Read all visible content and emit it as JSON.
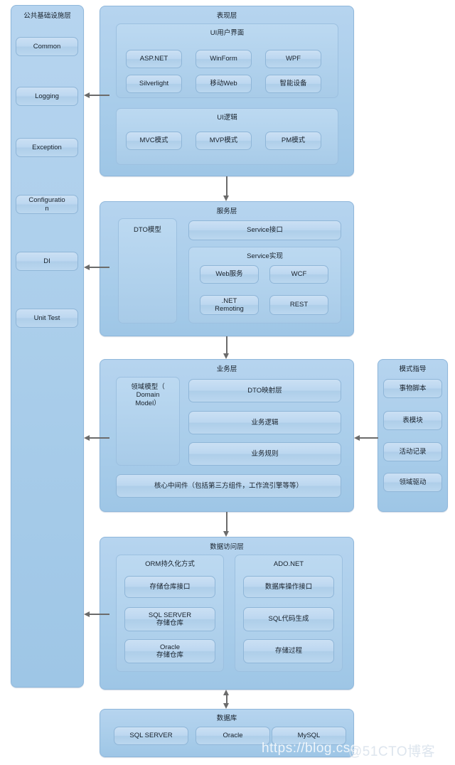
{
  "diagram": {
    "infrastructure": {
      "title": "公共基础设施层",
      "items": [
        {
          "label": "Common"
        },
        {
          "label": "Logging"
        },
        {
          "label": "Exception"
        },
        {
          "label": "Configuratio\nn"
        },
        {
          "label": "DI"
        },
        {
          "label": "Unit Test"
        }
      ]
    },
    "presentation": {
      "title": "表现层",
      "groups": [
        {
          "title": "UI用户界面",
          "items": [
            "ASP.NET",
            "WinForm",
            "WPF",
            "Silverlight",
            "移动Web",
            "智能设备"
          ]
        },
        {
          "title": "UI逻辑",
          "items": [
            "MVC模式",
            "MVP模式",
            "PM模式"
          ]
        }
      ]
    },
    "service": {
      "title": "服务层",
      "dto_model": "DTO模型",
      "interface": "Service接口",
      "impl": {
        "title": "Service实现",
        "items": [
          "Web服务",
          "WCF",
          ".NET\nRemoting",
          "REST"
        ]
      }
    },
    "business": {
      "title": "业务层",
      "domain_model": "领域模型（\nDomain\nModel）",
      "items": [
        "DTO映射层",
        "业务逻辑",
        "业务规则"
      ],
      "middleware": "核心中间件（包括第三方组件，工作流引擎等等）"
    },
    "patterns": {
      "title": "模式指导",
      "items": [
        "事物脚本",
        "表模块",
        "活动记录",
        "领域驱动"
      ]
    },
    "data_access": {
      "title": "数据访问层",
      "groups": [
        {
          "title": "ORM持久化方式",
          "items": [
            "存储仓库接口",
            "SQL SERVER\n存储仓库",
            "Oracle\n存储仓库"
          ]
        },
        {
          "title": "ADO.NET",
          "items": [
            "数据库操作接口",
            "SQL代码生成",
            "存储过程"
          ]
        }
      ]
    },
    "database": {
      "title": "数据库",
      "items": [
        "SQL SERVER",
        "Oracle",
        "MySQL"
      ]
    },
    "watermark": {
      "line1": "https://blog.csdn.net/D",
      "line2": "@51CTO博客"
    },
    "colors": {
      "panel_fill": "#aacfea",
      "panel_border": "#8fb7db",
      "box_fill": "#c1daf1",
      "box_border": "#8fb6d8",
      "connector": "#6b6b6b",
      "text": "#17202a"
    }
  }
}
